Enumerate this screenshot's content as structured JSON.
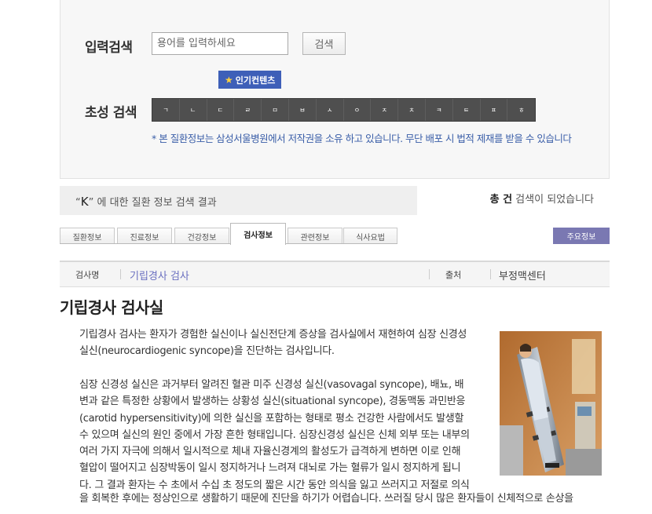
{
  "search": {
    "term_label": "입력검색",
    "placeholder": "용어를 입력하세요",
    "button_label": "검색",
    "popular_label": "인기컨텐츠",
    "initial_label": "초성 검색",
    "initials": [
      "ㄱ",
      "ㄴ",
      "ㄷ",
      "ㄹ",
      "ㅁ",
      "ㅂ",
      "ㅅ",
      "ㅇ",
      "ㅈ",
      "ㅊ",
      "ㅋ",
      "ㅌ",
      "ㅍ",
      "ㅎ"
    ],
    "copyright": "* 본 질환정보는 삼성서울병원에서 저작권을 소유 하고 있습니다. 무단 배포 시 법적 제재를 받을 수 있습니다"
  },
  "result": {
    "quote_open": "“",
    "keyword": "K",
    "quote_close": "”",
    "suffix": " 에 대한 질환 정보 검색 결과",
    "count_bold": "총 건",
    "count_suffix": " 검색이 되었습니다"
  },
  "tabs": [
    {
      "label": "질환정보"
    },
    {
      "label": "진료정보"
    },
    {
      "label": "건강정보"
    },
    {
      "label": "검사정보"
    },
    {
      "label": "관련정보"
    },
    {
      "label": "식사요법"
    }
  ],
  "main_info_button": "주요정보",
  "meta": {
    "name_label": "검사명",
    "name_value": "기립경사 검사",
    "source_label": "출처",
    "source_value": "부정맥센터"
  },
  "article": {
    "title": "기립경사 검사실",
    "p1_lines": [
      "기립경사 검사는 환자가 경험한 실신이나 실신전단계 증상을 검사실에서 재현하여 심장 신경성",
      "실신(neurocardiogenic syncope)을 진단하는 검사입니다."
    ],
    "p2_lines": [
      "심장 신경성 실신은 과거부터 알려진 혈관 미주 신경성 실신(vasovagal syncope), 배뇨, 배",
      "변과 같은 특정한 상황에서 발생하는 상황성 실신(situational syncope), 경동맥동 과민반응",
      "(carotid hypersensitivity)에 의한 실신을 포함하는 형태로 평소 건강한 사람에서도 발생할",
      "수 있으며 실신의 원인 중에서 가장 흔한 형태입니다. 심장신경성 실신은 신체 외부 또는 내부의",
      "여러 가지 자극에 의해서 일시적으로 체내 자율신경계의 활성도가 급격하게 변하면 이로 인해",
      "혈압이 떨어지고 심장박동이 일시 정지하거나 느려져 대뇌로 가는 혈류가 일시 정지하게 됩니",
      "다. 그 결과 환자는 수 초에서 수십 초 정도의 짧은 시간 동안 의식을 잃고 쓰러지고 저절로 의식"
    ],
    "p3_lines": [
      "을 회복한 후에는 정상인으로 생활하기 때문에 진단을 하기가 어렵습니다. 쓰러질 당시 많은 환자들이 신체적으로 손상을"
    ]
  }
}
